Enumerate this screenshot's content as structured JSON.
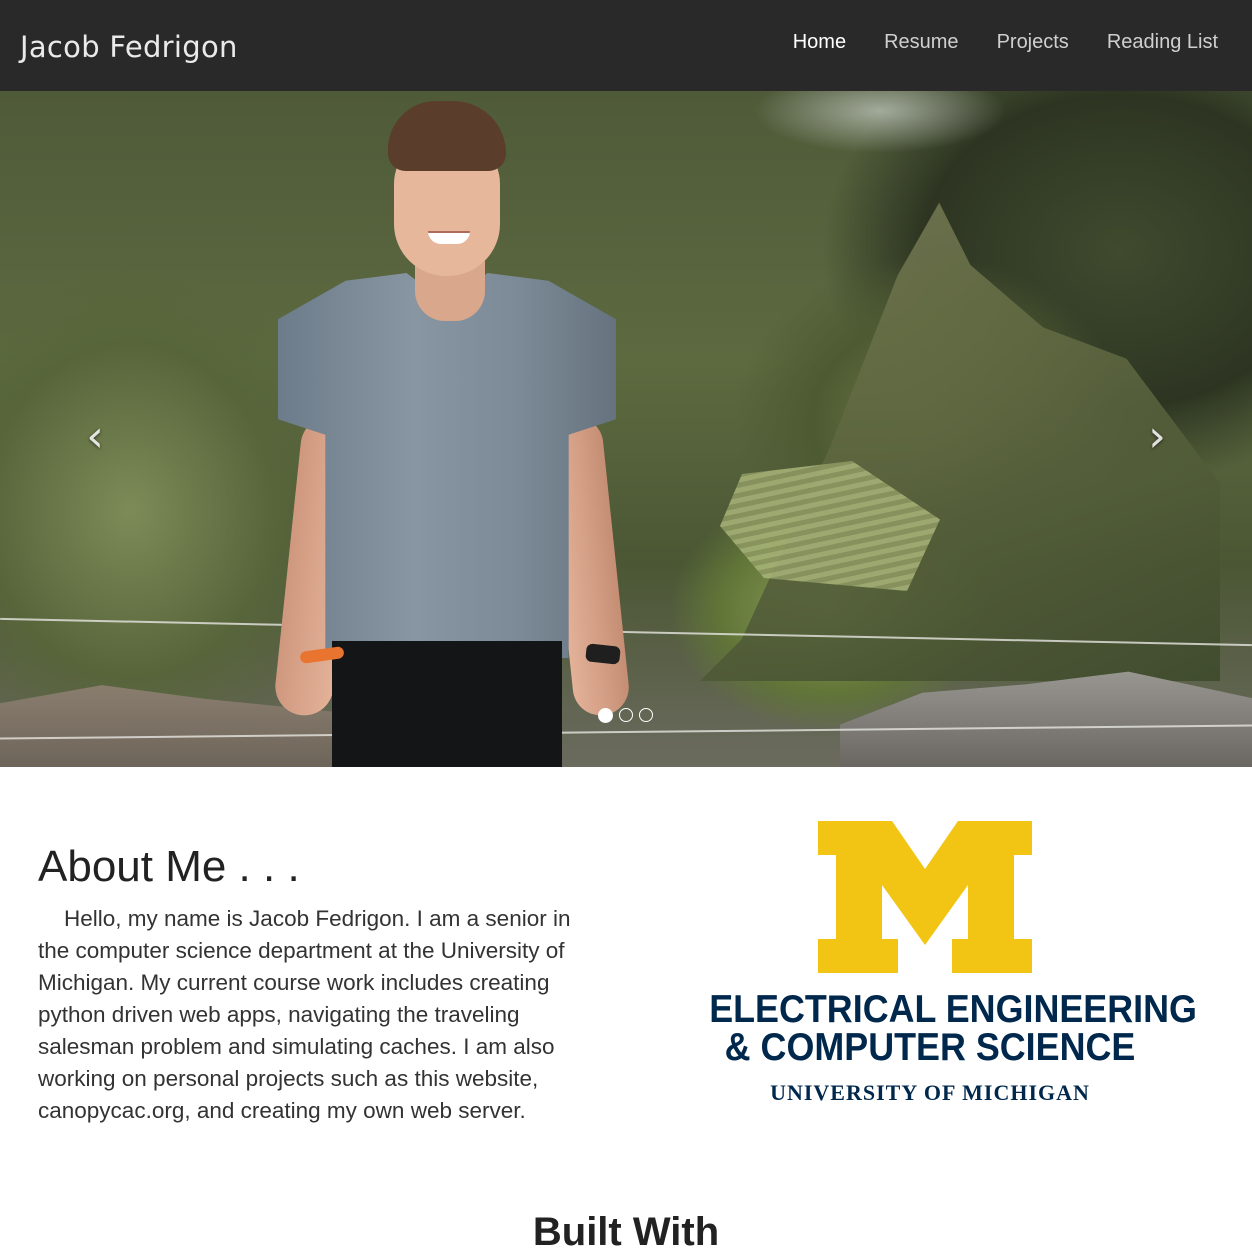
{
  "navbar": {
    "brand": "Jacob Fedrigon",
    "links": [
      {
        "label": "Home",
        "active": true
      },
      {
        "label": "Resume",
        "active": false
      },
      {
        "label": "Projects",
        "active": false
      },
      {
        "label": "Reading List",
        "active": false
      }
    ]
  },
  "carousel": {
    "prev_icon": "chevron-left-icon",
    "next_icon": "chevron-right-icon",
    "prev_glyph": "‹",
    "next_glyph": "›",
    "slide_count": 3,
    "active_index": 0
  },
  "about": {
    "title": "About Me . . .",
    "text": "Hello, my name is Jacob Fedrigon. I am a senior in the computer science department at the University of Michigan. My current course work includes creating python driven web apps, navigating the traveling salesman problem and simulating caches. I am also working on personal projects such as this website, canopycac.org, and creating my own web server."
  },
  "logo": {
    "line1": "ELECTRICAL ENGINEERING",
    "line2": "& COMPUTER SCIENCE",
    "line3": "UNIVERSITY OF MICHIGAN",
    "colors": {
      "maize": "#f2c413",
      "blue": "#00274c"
    }
  },
  "built_with": {
    "title": "Built With"
  },
  "colors": {
    "navbar_bg": "#2a2929",
    "nav_active": "#ffffff",
    "nav_inactive": "#cfcfcf"
  }
}
